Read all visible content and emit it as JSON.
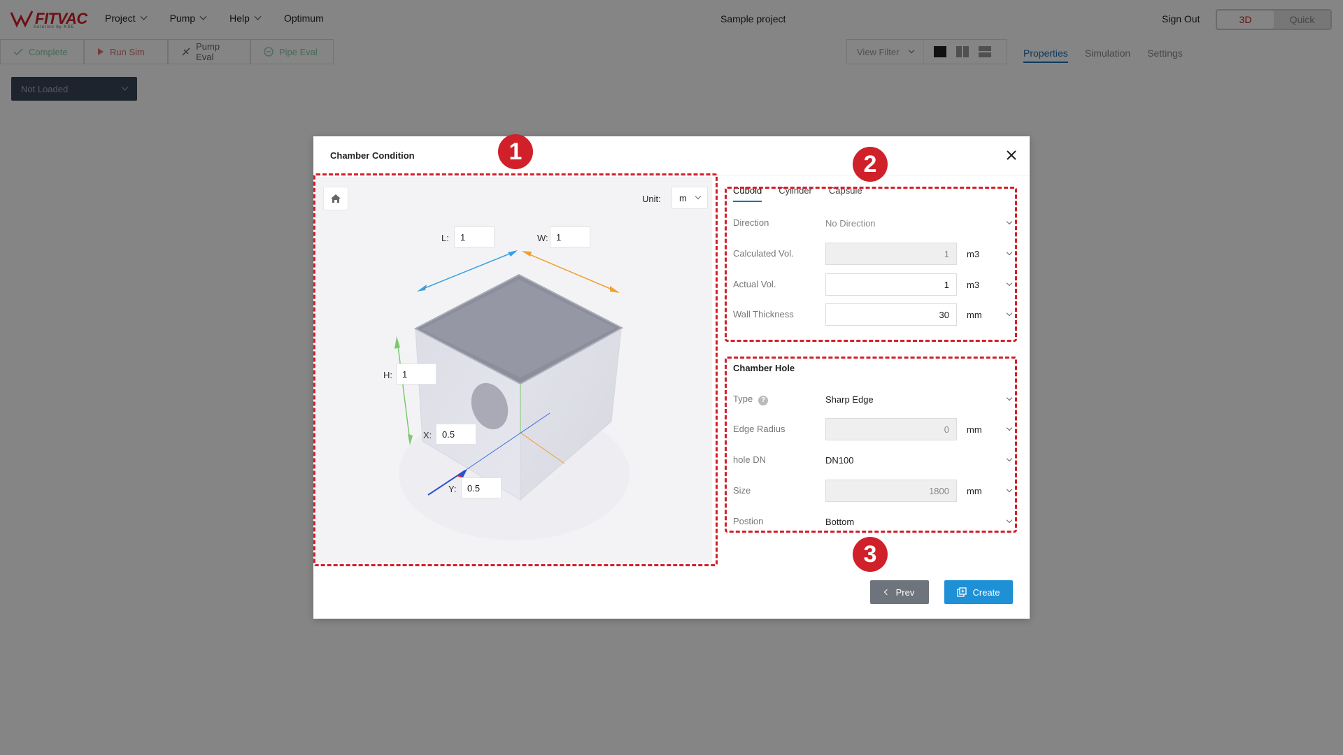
{
  "app": {
    "logo_text": "FITVAC",
    "logo_subtext": "Solution by KSE",
    "menu": [
      {
        "label": "Project"
      },
      {
        "label": "Pump"
      },
      {
        "label": "Help"
      },
      {
        "label": "Optimum"
      }
    ],
    "project_name": "Sample project",
    "sign_out": "Sign Out",
    "mode": {
      "option_3d": "3D",
      "option_quick": "Quick",
      "selected": "3D"
    }
  },
  "toolbar": {
    "complete": "Complete",
    "run_sim": "Run Sim",
    "pump_eval": "Pump Eval",
    "pipe_eval": "Pipe Eval",
    "view_filter": "View Filter"
  },
  "right_panel": {
    "tabs": [
      "Properties",
      "Simulation",
      "Settings"
    ],
    "active_tab": "Properties"
  },
  "left_panel": {
    "not_loaded": "Not Loaded"
  },
  "modal": {
    "title": "Chamber Condition",
    "callouts": [
      "1",
      "2",
      "3"
    ],
    "viewport": {
      "unit_label": "Unit:",
      "unit_value": "m",
      "L_label": "L:",
      "L_value": "1",
      "W_label": "W:",
      "W_value": "1",
      "H_label": "H:",
      "H_value": "1",
      "X_label": "X:",
      "X_value": "0.5",
      "Y_label": "Y:",
      "Y_value": "0.5"
    },
    "shape_tabs": [
      "Cuboid",
      "Cylinder",
      "Capsule"
    ],
    "active_shape": "Cuboid",
    "fields": {
      "direction": {
        "label": "Direction",
        "value": "No Direction"
      },
      "calculated_vol": {
        "label": "Calculated Vol.",
        "value": "1",
        "unit": "m3"
      },
      "actual_vol": {
        "label": "Actual Vol.",
        "value": "1",
        "unit": "m3"
      },
      "wall_thickness": {
        "label": "Wall Thickness",
        "value": "30",
        "unit": "mm"
      }
    },
    "chamber_hole": {
      "title": "Chamber Hole",
      "type": {
        "label": "Type",
        "value": "Sharp Edge"
      },
      "edge_radius": {
        "label": "Edge Radius",
        "value": "0",
        "unit": "mm"
      },
      "hole_dn": {
        "label": "hole DN",
        "value": "DN100"
      },
      "size": {
        "label": "Size",
        "value": "1800",
        "unit": "mm"
      },
      "position": {
        "label": "Postion",
        "value": "Bottom"
      }
    },
    "buttons": {
      "prev": "Prev",
      "create": "Create"
    }
  },
  "colors": {
    "brand_red": "#d0202a",
    "accent_blue": "#1e90d6",
    "axis_blue": "#3aa0e0",
    "axis_orange": "#f0a030",
    "axis_green": "#7cc870"
  }
}
